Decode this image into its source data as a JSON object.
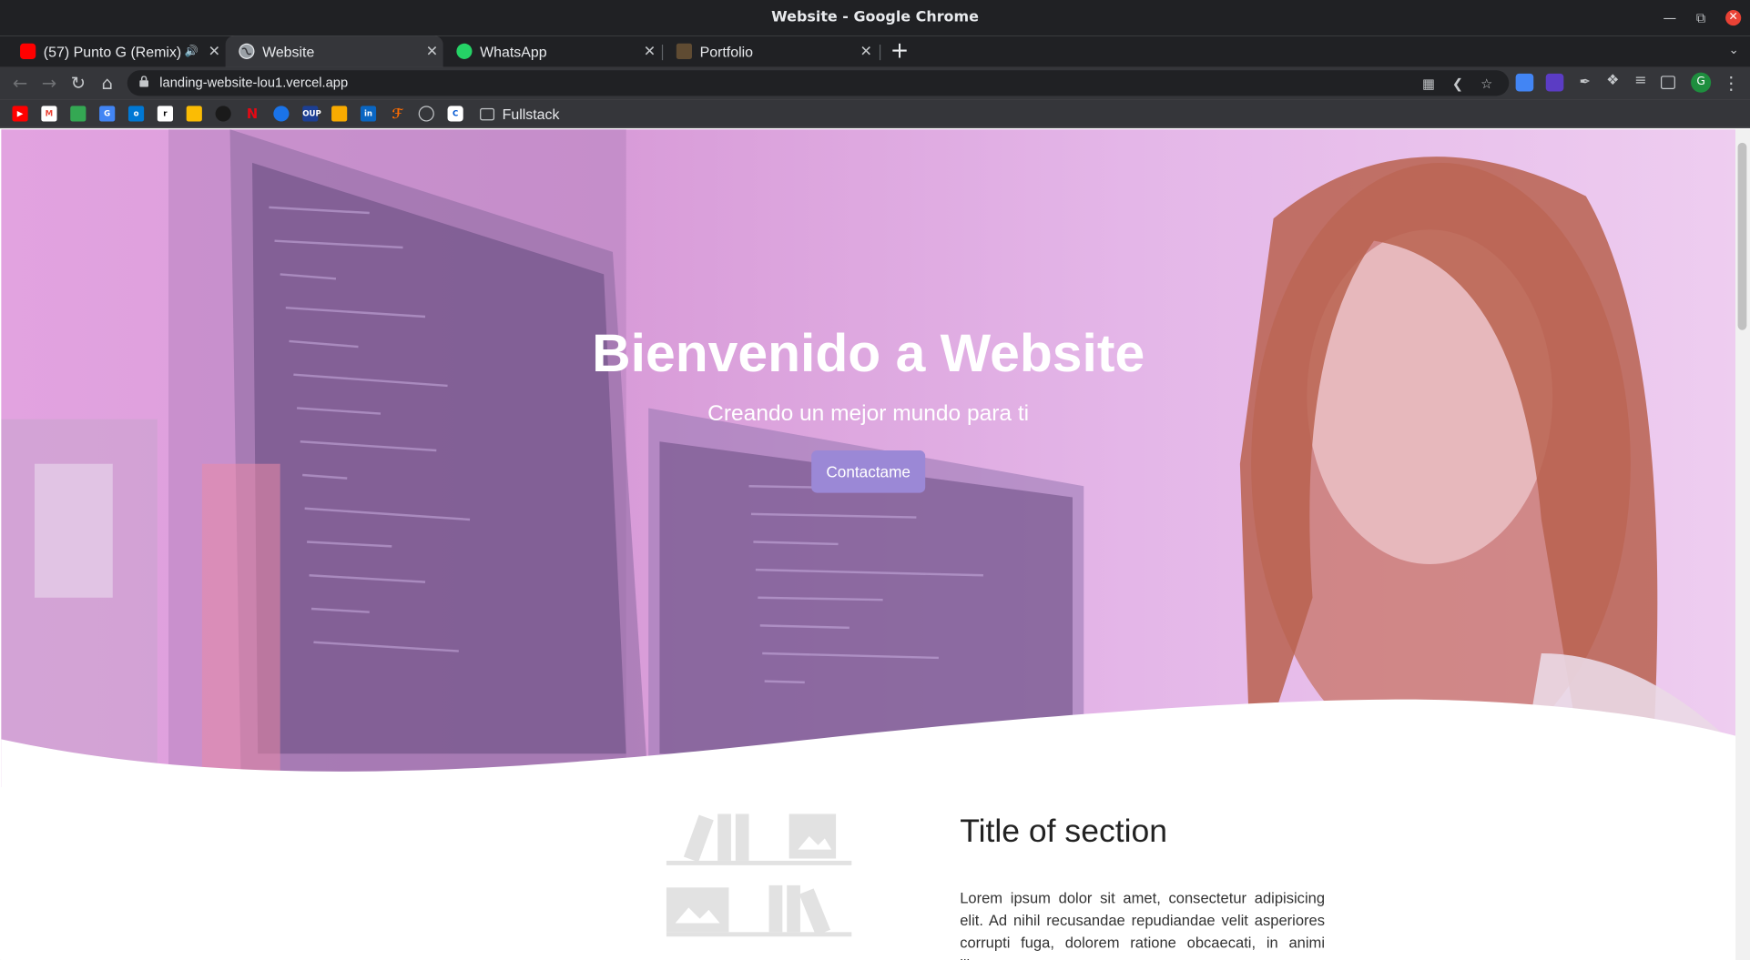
{
  "window": {
    "title": "Website - Google Chrome"
  },
  "tabs": [
    {
      "label": "(57) Punto G (Remix) -",
      "favicon": "youtube-icon",
      "color": "#ff0000"
    },
    {
      "label": "Website",
      "favicon": "globe-icon",
      "color": "#e8eaed"
    },
    {
      "label": "WhatsApp",
      "favicon": "whatsapp-icon",
      "color": "#25d366"
    },
    {
      "label": "Portfolio",
      "favicon": "briefcase-icon",
      "color": "#e8eaed"
    }
  ],
  "active_tab_index": 1,
  "audio_icon": "speaker-icon",
  "omnibox": {
    "url": "landing-website-lou1.vercel.app"
  },
  "profile": {
    "initial": "G"
  },
  "bookmarks": {
    "icons": [
      "youtube",
      "gmail",
      "maps",
      "translate",
      "outlook",
      "rstudio",
      "drive",
      "openai",
      "netflix",
      "globe",
      "oup",
      "sheets",
      "linkedin",
      "lexis",
      "github",
      "coursera"
    ],
    "folder_label": "Fullstack"
  },
  "hero": {
    "title": "Bienvenido a Website",
    "subtitle": "Creando un mejor mundo para ti",
    "button_label": "Contactame"
  },
  "section": {
    "title": "Title of section",
    "body": "Lorem ipsum dolor sit amet, consectetur adipisicing elit. Ad nihil recusandae repudiandae velit asperiores corrupti fuga, dolorem ratione obcaecati, in animi libero"
  },
  "colors": {
    "hero_overlay": "#e2a3e0",
    "button": "#9b88d6",
    "chrome_dark": "#202124",
    "chrome_toolbar": "#35363a"
  }
}
